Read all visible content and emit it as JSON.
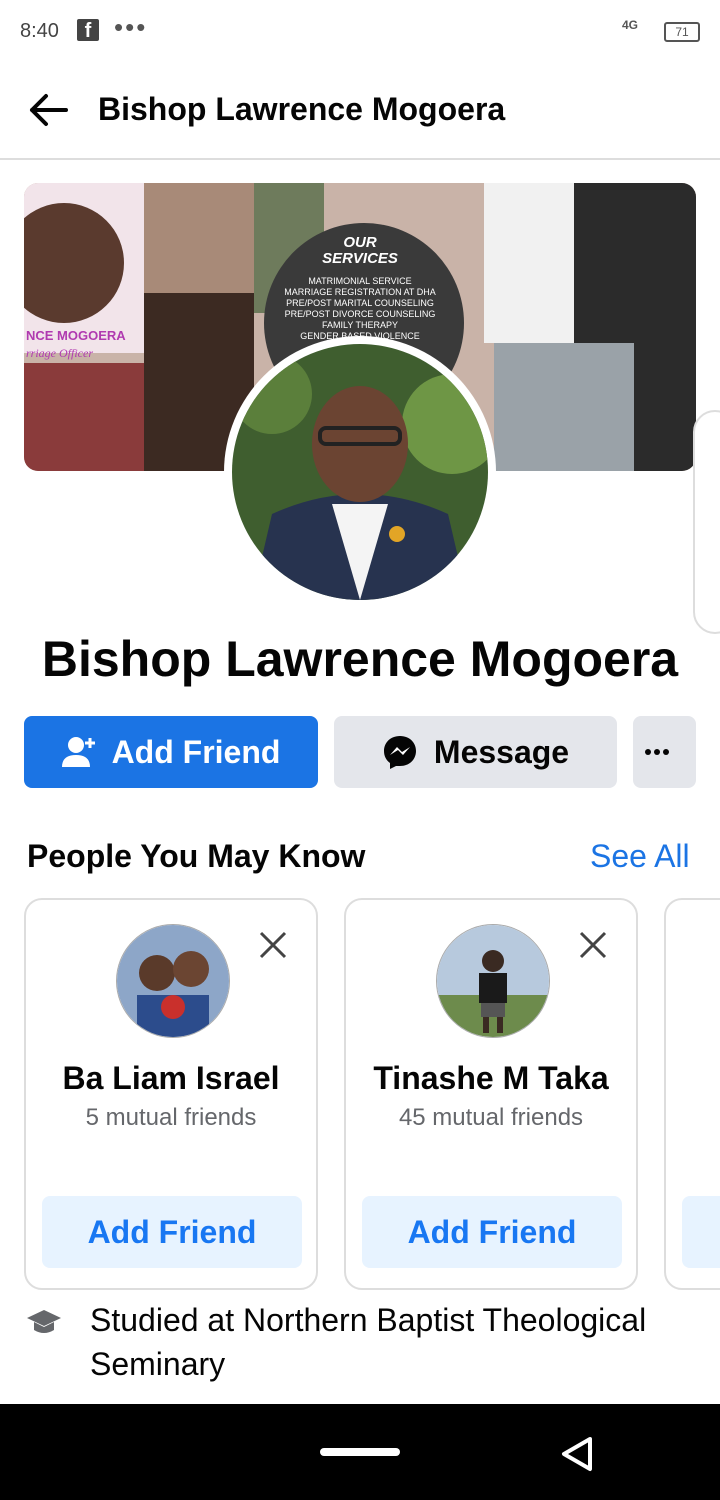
{
  "status_bar": {
    "time": "8:40",
    "app_notification_icon": "facebook-icon",
    "network": "4G",
    "battery": "71"
  },
  "header": {
    "title": "Bishop Lawrence Mogoera",
    "back_icon": "arrow-left-icon"
  },
  "cover": {
    "banner_title": "OUR SERVICES",
    "banner_items": [
      "MATRIMONIAL SERVICE",
      "MARRIAGE REGISTRATION AT DHA",
      "PRE/POST MARITAL COUNSELING",
      "PRE/POST DIVORCE COUNSELING",
      "FAMILY THERAPY",
      "GENDER BASED VIOLENCE"
    ],
    "name_overlay": "NCE MOGOERA",
    "subtitle_overlay": "rriage Officer"
  },
  "profile": {
    "name": "Bishop Lawrence Mogoera"
  },
  "actions": {
    "add_friend_label": "Add Friend",
    "message_label": "Message",
    "more_label": "..."
  },
  "people_you_may_know": {
    "title": "People You May Know",
    "see_all_label": "See All",
    "cards": [
      {
        "name": "Ba Liam Israel",
        "mutual": "5 mutual friends",
        "button_label": "Add Friend"
      },
      {
        "name": "Tinashe M Taka",
        "mutual": "45 mutual friends",
        "button_label": "Add Friend"
      }
    ]
  },
  "education": {
    "text": "Studied at Northern Baptist Theological Seminary",
    "icon": "graduation-cap-icon"
  },
  "colors": {
    "primary": "#1b74e4",
    "secondary_button": "#e4e6eb",
    "light_button": "#e7f3ff"
  }
}
